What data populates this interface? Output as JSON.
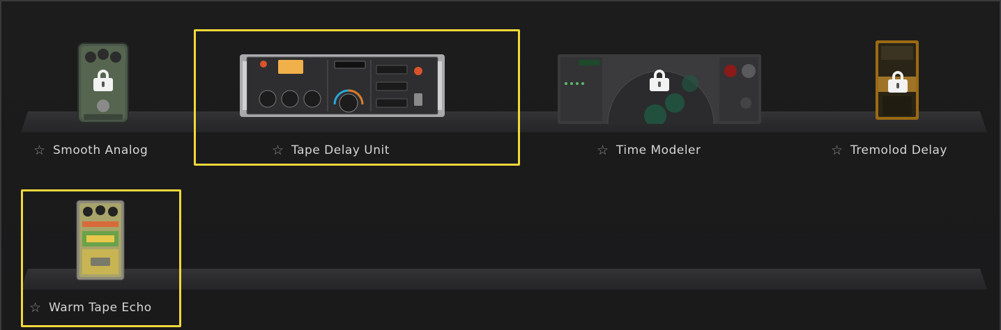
{
  "effects": [
    {
      "name": "Smooth Analog",
      "locked": true,
      "favorite": false
    },
    {
      "name": "Tape Delay Unit",
      "locked": false,
      "favorite": false
    },
    {
      "name": "Time Modeler",
      "locked": true,
      "favorite": false
    },
    {
      "name": "Tremolod Delay",
      "locked": true,
      "favorite": false
    },
    {
      "name": "Warm Tape Echo",
      "locked": false,
      "favorite": false
    }
  ],
  "icons": {
    "star": "☆",
    "lock": "lock-icon"
  },
  "colors": {
    "background": "#1d1d1e",
    "shelf": "#2f2f31",
    "label_text": "#d6d6d6",
    "star": "#8e8e90",
    "highlight": "#f1d83a"
  }
}
